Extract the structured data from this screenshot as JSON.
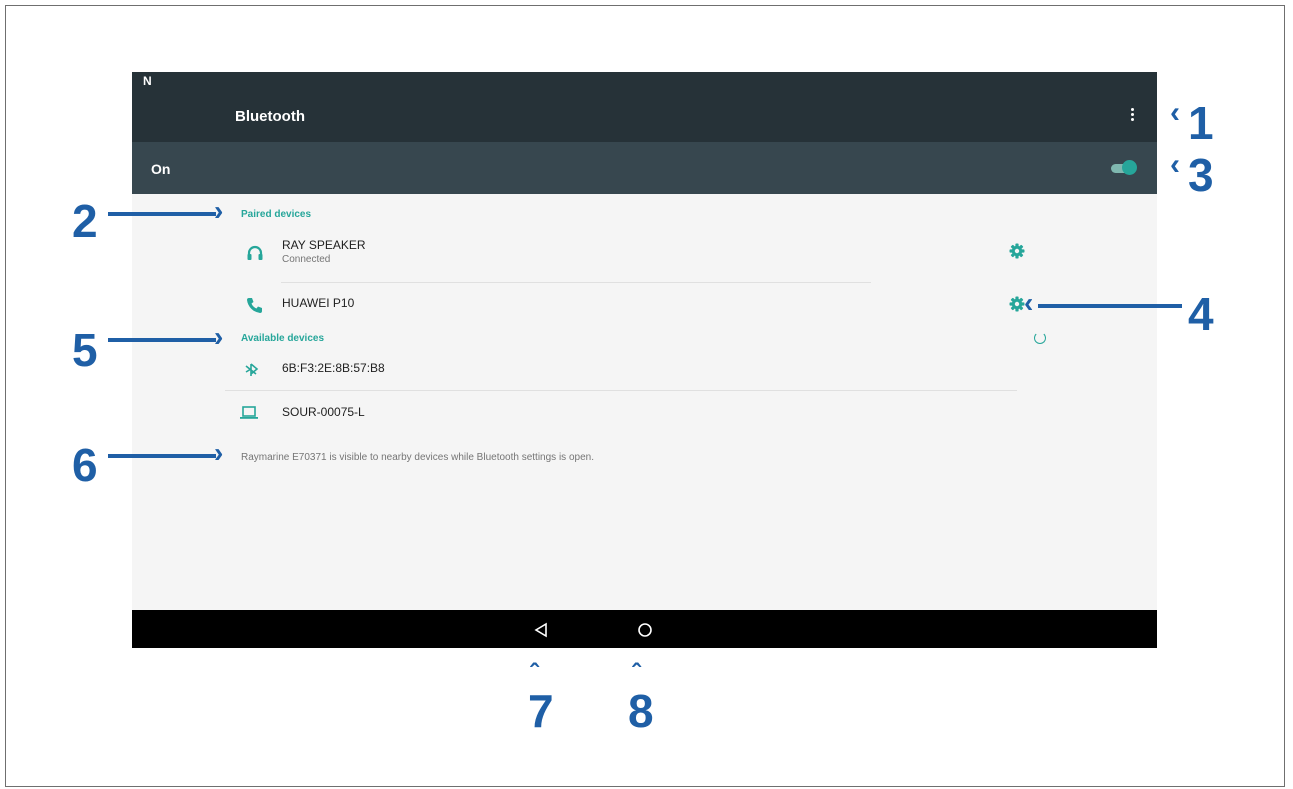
{
  "screen": {
    "toolbar": {
      "title": "Bluetooth",
      "menu_icon": "more-vertical-icon"
    },
    "switch": {
      "label": "On",
      "state": "on"
    },
    "paired_header": "Paired devices",
    "paired_devices": [
      {
        "icon": "headphones-icon",
        "name": "RAY SPEAKER",
        "status": "Connected"
      },
      {
        "icon": "phone-icon",
        "name": "HUAWEI P10",
        "status": ""
      }
    ],
    "available_header": "Available devices",
    "available_devices": [
      {
        "icon": "bluetooth-icon",
        "name": "6B:F3:2E:8B:57:B8"
      },
      {
        "icon": "laptop-icon",
        "name": "SOUR-00075-L"
      }
    ],
    "visibility_text": "Raymarine E70371 is visible to nearby devices while Bluetooth settings is open.",
    "nav": {
      "back_icon": "back-triangle-icon",
      "home_icon": "home-circle-icon"
    }
  },
  "callouts": [
    "1",
    "2",
    "3",
    "4",
    "5",
    "6",
    "7",
    "8"
  ],
  "colors": {
    "accent": "#26a69a",
    "toolbar": "#263238",
    "switchbar": "#37474f",
    "callout": "#1f5fa6"
  }
}
